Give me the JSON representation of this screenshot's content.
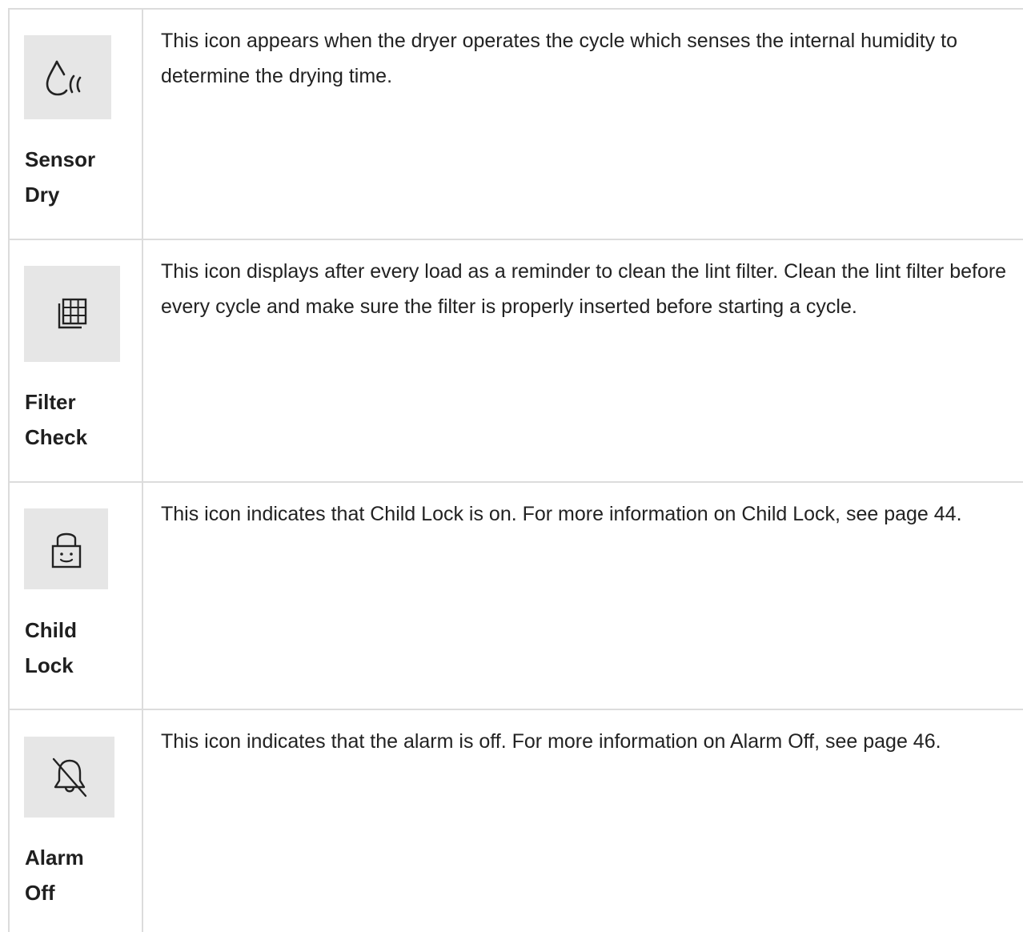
{
  "rows": [
    {
      "icon": "sensor-dry-icon",
      "name_line1": "Sensor",
      "name_line2": "Dry",
      "description": "This icon appears when the dryer operates the cycle which senses the internal humidity to determine the drying time."
    },
    {
      "icon": "filter-check-icon",
      "name_line1": "Filter",
      "name_line2": "Check",
      "description": "This icon displays after every load as a reminder to clean the lint filter. Clean the lint filter before every cycle and make sure the filter is properly inserted before starting a cycle."
    },
    {
      "icon": "child-lock-icon",
      "name_line1": "Child",
      "name_line2": "Lock",
      "description": "This icon indicates that Child Lock is on. For more information on Child Lock, see page 44."
    },
    {
      "icon": "alarm-off-icon",
      "name_line1": "Alarm",
      "name_line2": "Off",
      "description": "This icon indicates that the alarm is off. For more information on Alarm Off, see page 46."
    }
  ],
  "colors": {
    "border": "#dcdcdc",
    "icon_background": "#e6e6e6",
    "text": "#1f1f1f"
  }
}
